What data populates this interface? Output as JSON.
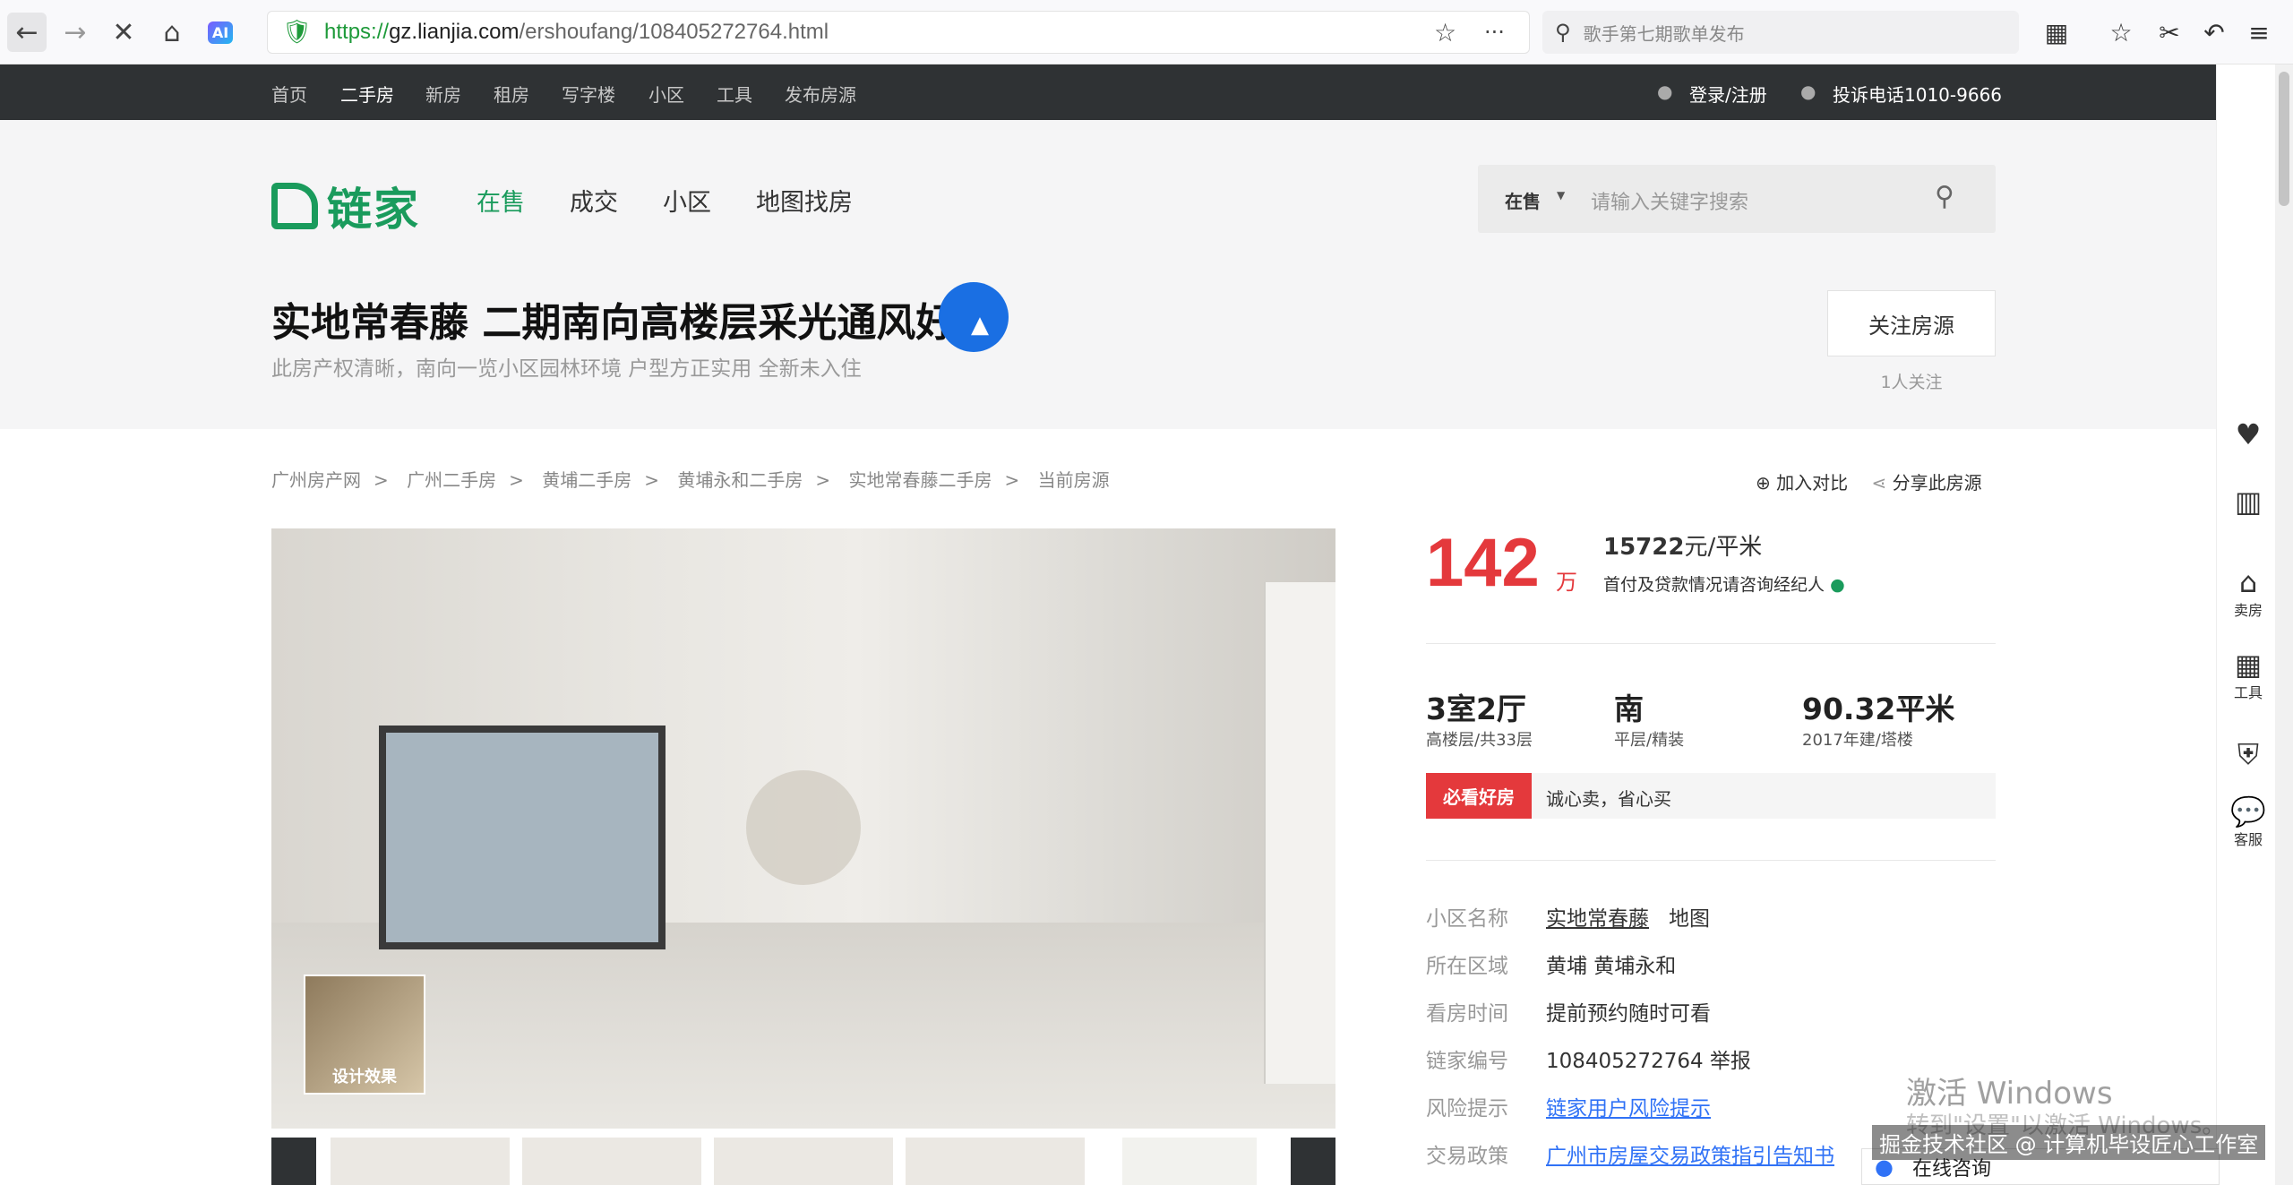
{
  "browser": {
    "url_prefix": "https://",
    "url_domain": "gz.lianjia.com",
    "url_path": "/ershoufang/108405272764.html",
    "search_placeholder": "歌手第七期歌单发布",
    "ai_label": "AI"
  },
  "topnav": {
    "items": [
      "首页",
      "二手房",
      "新房",
      "租房",
      "写字楼",
      "小区",
      "工具",
      "发布房源"
    ],
    "login": "登录/注册",
    "hotline": "投诉电话1010-9666"
  },
  "header": {
    "logo_text": "链家",
    "nav": [
      "在售",
      "成交",
      "小区",
      "地图找房"
    ],
    "search_scope": "在售",
    "search_placeholder": "请输入关键字搜索",
    "title": "实地常春藤 二期南向高楼层采光通风好",
    "subtitle": "此房产权清晰，南向一览小区园林环境 户型方正实用 全新未入住",
    "follow_button": "关注房源",
    "follow_count": "1人关注"
  },
  "breadcrumb": [
    "广州房产网",
    "广州二手房",
    "黄埔二手房",
    "黄埔永和二手房",
    "实地常春藤二手房",
    "当前房源"
  ],
  "actions": {
    "compare": "加入对比",
    "share": "分享此房源"
  },
  "photo": {
    "design_label": "设计效果"
  },
  "price": {
    "total": "142",
    "total_unit": "万",
    "unit_value": "15722",
    "unit_suffix": "元/平米",
    "note": "首付及贷款情况请咨询经纪人"
  },
  "attributes": [
    {
      "main": "3室2厅",
      "sub": "高楼层/共33层"
    },
    {
      "main": "南",
      "sub": "平层/精装"
    },
    {
      "main": "90.32平米",
      "sub": "2017年建/塔楼"
    }
  ],
  "tag": {
    "label": "必看好房",
    "text": "诚心卖，省心买"
  },
  "info": [
    {
      "k": "小区名称",
      "v": "实地常春藤",
      "extra": "地图"
    },
    {
      "k": "所在区域",
      "v": "黄埔 黄埔永和"
    },
    {
      "k": "看房时间",
      "v": "提前预约随时可看"
    },
    {
      "k": "链家编号",
      "v": "108405272764",
      "extra": "举报"
    },
    {
      "k": "风险提示",
      "v": "链家用户风险提示"
    },
    {
      "k": "交易政策",
      "v": "广州市房屋交易政策指引告知书"
    }
  ],
  "rail": [
    "卖房",
    "工具",
    "客服"
  ],
  "overlay": {
    "win_activate": "激活 Windows",
    "win_activate_sub": "转到\"设置\"以激活 Windows。",
    "csdn": "掘金技术社区 @ 计算机毕设匠心工作室",
    "consult": "在线咨询"
  },
  "colors": {
    "brand_green": "#1a9b5c",
    "price_red": "#e4393c",
    "topnav_bg": "#2f3234",
    "link_blue": "#3072f6"
  }
}
